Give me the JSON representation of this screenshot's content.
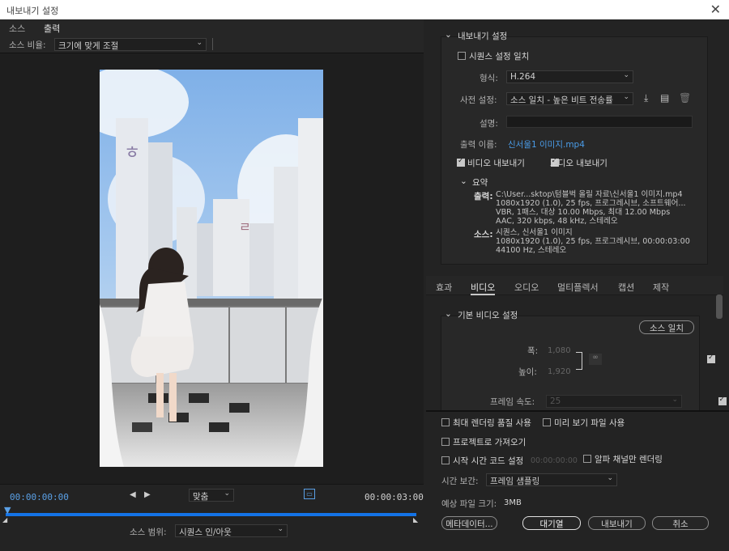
{
  "window": {
    "title": "내보내기 설정",
    "close_glyph": "✕"
  },
  "left": {
    "tabs": [
      {
        "label": "소스"
      },
      {
        "label": "출력"
      }
    ],
    "source_scaling": {
      "label": "소스 비율:",
      "value": "크기에 맞게 조절"
    },
    "timeline": {
      "start_tc": "00:00:00:00",
      "end_tc": "00:00:03:00",
      "fit_value": "맞춤",
      "range_label": "소스 범위:",
      "range_value": "시퀀스 인/아웃"
    }
  },
  "export_settings": {
    "header": "내보내기 설정",
    "match_sequence": "시퀀스 설정 일치",
    "format_label": "형식:",
    "format_value": "H.264",
    "preset_label": "사전 설정:",
    "preset_value": "소스 일치 - 높은 비트 전송률",
    "comments_label": "설명:",
    "output_name_label": "출력 이름:",
    "output_name_value": "신서울1 이미지.mp4",
    "export_video": "비디오 내보내기",
    "export_audio": "오디오 내보내기",
    "summary_header": "요약",
    "summary_output_label": "출력:",
    "summary_output_lines": [
      "C:\\User...sktop\\텀블벅 올릴 자료\\신서울1 이미지.mp4",
      "1080x1920 (1.0), 25 fps, 프로그레시브, 소프트웨어...",
      "VBR, 1패스, 대상 10.00 Mbps, 최대 12.00 Mbps",
      "AAC, 320 kbps, 48 kHz, 스테레오"
    ],
    "summary_source_label": "소스:",
    "summary_source_lines": [
      "시퀀스, 신서울1 이미지",
      "1080x1920 (1.0), 25 fps, 프로그레시브, 00:00:03:00",
      "44100 Hz, 스테레오"
    ]
  },
  "mid_tabs": [
    {
      "label": "효과"
    },
    {
      "label": "비디오"
    },
    {
      "label": "오디오"
    },
    {
      "label": "멀티플렉서"
    },
    {
      "label": "캡션"
    },
    {
      "label": "제작"
    }
  ],
  "video": {
    "basic_header": "기본 비디오 설정",
    "match_source_btn": "소스 일치",
    "width_label": "폭:",
    "width_value": "1,080",
    "height_label": "높이:",
    "height_value": "1,920",
    "framerate_label": "프레임 속도:",
    "framerate_value": "25"
  },
  "bottom": {
    "max_render": "최대 렌더링 품질 사용",
    "use_previews": "미리 보기 파일 사용",
    "import_project": "프로젝트로 가져오기",
    "start_tc": "시작 시간 코드 설정",
    "start_tc_value": "00:00:00:00",
    "alpha_only": "알파 채널만 렌더링",
    "interp_label": "시간 보간:",
    "interp_value": "프레임 샘플링",
    "filesize_label": "예상 파일 크기:",
    "filesize_value": "3MB",
    "btn_metadata": "메타데이터...",
    "btn_queue": "대기열",
    "btn_export": "내보내기",
    "btn_cancel": "취소"
  },
  "colors": {
    "accent": "#1473e6",
    "timecode": "#5aa0e6",
    "link": "#4a9ce8"
  }
}
